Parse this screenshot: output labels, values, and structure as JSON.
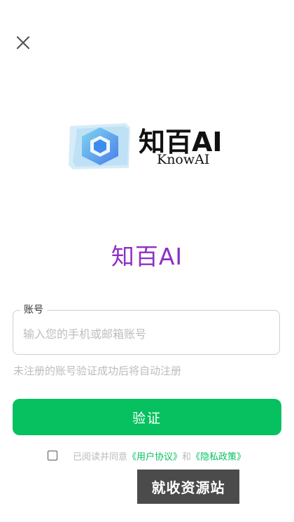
{
  "header": {
    "close_icon": "close-icon"
  },
  "logo": {
    "title": "知百AI",
    "subtitle": "KnowAI",
    "icon": "hexagon-logo-icon"
  },
  "app_name": "知百AI",
  "account_field": {
    "label": "账号",
    "placeholder": "输入您的手机或邮箱账号",
    "value": ""
  },
  "hint": "未注册的账号验证成功后将自动注册",
  "verify_button": "验证",
  "agreement": {
    "checked": false,
    "prefix": "已阅读并同意",
    "user_agreement": "《用户协议》",
    "conjunction": "和",
    "privacy_policy": "《隐私政策》"
  },
  "watermark": "就收资源站",
  "colors": {
    "primary_green": "#07c160",
    "app_name_purple": "#8f2fc2",
    "logo_blue": "#3d8cf0"
  }
}
